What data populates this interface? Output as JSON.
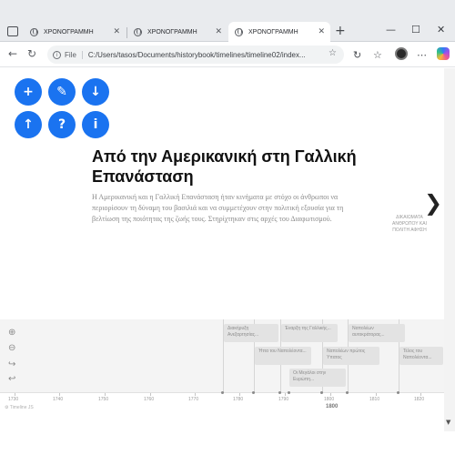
{
  "browser": {
    "tabs": [
      {
        "label": "ΧΡΟΝΟΓΡΑΜΜΗ",
        "active": false
      },
      {
        "label": "ΧΡΟΝΟΓΡΑΜΜΗ",
        "active": false
      },
      {
        "label": "ΧΡΟΝΟΓΡΑΜΜΗ",
        "active": true
      }
    ],
    "new_tab": "+",
    "controls": {
      "minimize": "—",
      "maximize": "☐",
      "close": "✕"
    },
    "nav": {
      "back": "←",
      "reload": "↻"
    },
    "address": {
      "scheme_label": "File",
      "url": "C:/Users/tasos/Documents/historybook/timelines/timeline02/index..."
    }
  },
  "toolbar_icons": [
    "zoom-icon",
    "star-icon",
    "refresh-icon",
    "favorites-icon",
    "profile-avatar",
    "copilot-icon"
  ],
  "fab_buttons": [
    {
      "name": "add",
      "glyph": "+"
    },
    {
      "name": "edit",
      "glyph": "✎"
    },
    {
      "name": "download",
      "glyph": "↓"
    },
    {
      "name": "upload",
      "glyph": "↑"
    },
    {
      "name": "help",
      "glyph": "?"
    },
    {
      "name": "info",
      "glyph": "i"
    }
  ],
  "slide": {
    "title": "Από την Αμερικανική στη Γαλλική Επανάσταση",
    "description": "Η Αμερικανική και η Γαλλική Επανάσταση ήταν κινήματα με στόχο οι άνθρωποι να περιορίσουν τη δύναμη του βασιλιά και να συμμετέχουν στην πολιτική εξουσία για τη βελτίωση της ποιότητας της ζωής τους. Στηρίχτηκαν στις αρχές του Διαφωτισμού."
  },
  "next": {
    "arrow": "❯",
    "label": "ΔΙΚΑΙΩΜΑΤΑ ΑΝΘΡΩΠΟΥ ΚΑΙ ΠΟΛΙΤΗ ΑΦΗΣΗ"
  },
  "timeline_tools": [
    "zoom-in-icon",
    "zoom-out-icon",
    "forward-icon",
    "back-icon"
  ],
  "events": [
    {
      "label": "Διακήρυξη Ανεξαρτησίας..."
    },
    {
      "label": "Έναρξη της Γαλλικής..."
    },
    {
      "label": "Ναπολέων αυτοκράτορας..."
    },
    {
      "label": "Ήττα του Ναπολέοντα..."
    },
    {
      "label": "Ναπολέων πρώτος Υπατος"
    },
    {
      "label": "Τέλος του Ναπολέοντα..."
    },
    {
      "label": "Οι Μεγάλοι στην Ευρώπη..."
    }
  ],
  "axis": {
    "ticks": [
      "1730",
      "1740",
      "1750",
      "1760",
      "1770",
      "1780",
      "1790",
      "1800",
      "1810",
      "1820"
    ],
    "major": "1800",
    "credit": "⚙ Timeline JS"
  }
}
